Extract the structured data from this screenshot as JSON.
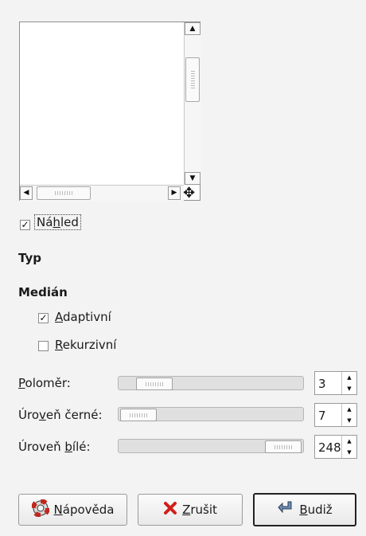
{
  "preview": {
    "checkbox_checked": true,
    "label_pre": "Ná",
    "label_mn": "h",
    "label_post": "led"
  },
  "type_heading": "Typ",
  "median": {
    "heading": "Medián",
    "adaptive": {
      "mn": "A",
      "rest": "daptivní",
      "checked": true
    },
    "recursive": {
      "mn": "R",
      "rest": "ekurzivní",
      "checked": false
    }
  },
  "params": [
    {
      "label_mn": "P",
      "label_rest": "oloměr:",
      "value": "3",
      "fraction": 0.02
    },
    {
      "label_pre": "Úro",
      "label_mn": "v",
      "label_rest": "eň černé:",
      "value": "7",
      "fraction": 0.0
    },
    {
      "label_pre": "Úroveň ",
      "label_mn": "b",
      "label_rest": "ílé:",
      "value": "248",
      "fraction": 0.97
    }
  ],
  "buttons": {
    "help": {
      "mn": "N",
      "rest": "ápověda"
    },
    "cancel": {
      "mn": "Z",
      "rest": "rušit"
    },
    "ok": {
      "mn": "B",
      "rest": "udiž"
    }
  }
}
